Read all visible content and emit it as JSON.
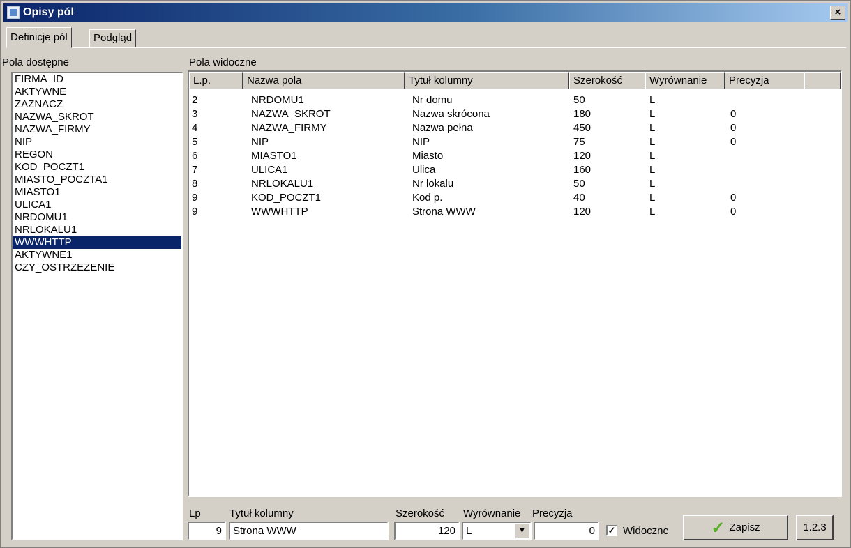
{
  "window": {
    "title": "Opisy pól",
    "close_label": "×"
  },
  "tabs": [
    {
      "label": "Definicje pól",
      "active": true
    },
    {
      "label": "Podgląd",
      "active": false
    }
  ],
  "left_panel": {
    "label": "Pola dostępne",
    "items": [
      "FIRMA_ID",
      "AKTYWNE",
      "ZAZNACZ",
      "NAZWA_SKROT",
      "NAZWA_FIRMY",
      "NIP",
      "REGON",
      "KOD_POCZT1",
      "MIASTO_POCZTA1",
      "MIASTO1",
      "ULICA1",
      "NRDOMU1",
      "NRLOKALU1",
      "WWWHTTP",
      "AKTYWNE1",
      "CZY_OSTRZEZENIE"
    ],
    "selected_index": 13
  },
  "grid": {
    "label": "Pola widoczne",
    "columns": [
      "L.p.",
      "Nazwa pola",
      "Tytuł kolumny",
      "Szerokość",
      "Wyrównanie",
      "Precyzja"
    ],
    "rows": [
      [
        "2",
        "NRDOMU1",
        "Nr domu",
        "50",
        "L",
        ""
      ],
      [
        "3",
        "NAZWA_SKROT",
        "Nazwa skrócona",
        "180",
        "L",
        "0"
      ],
      [
        "4",
        "NAZWA_FIRMY",
        "Nazwa pełna",
        "450",
        "L",
        "0"
      ],
      [
        "5",
        "NIP",
        "NIP",
        "75",
        "L",
        "0"
      ],
      [
        "6",
        "MIASTO1",
        "Miasto",
        "120",
        "L",
        ""
      ],
      [
        "7",
        "ULICA1",
        "Ulica",
        "160",
        "L",
        ""
      ],
      [
        "8",
        "NRLOKALU1",
        "Nr lokalu",
        "50",
        "L",
        ""
      ],
      [
        "9",
        "KOD_POCZT1",
        "Kod p.",
        "40",
        "L",
        "0"
      ],
      [
        "9",
        "WWWHTTP",
        "Strona WWW",
        "120",
        "L",
        "0"
      ]
    ]
  },
  "editor": {
    "lp_label": "Lp",
    "lp_value": "9",
    "title_label": "Tytuł kolumny",
    "title_value": "Strona WWW",
    "width_label": "Szerokość",
    "width_value": "120",
    "align_label": "Wyrównanie",
    "align_value": "L",
    "precision_label": "Precyzja",
    "precision_value": "0",
    "visible_label": "Widoczne",
    "visible_checked": true,
    "save_label": "Zapisz",
    "version_label": "1.2.3"
  },
  "colors": {
    "selection": "#0a246a",
    "face": "#d4d0c8",
    "check_icon": "#58b028"
  }
}
